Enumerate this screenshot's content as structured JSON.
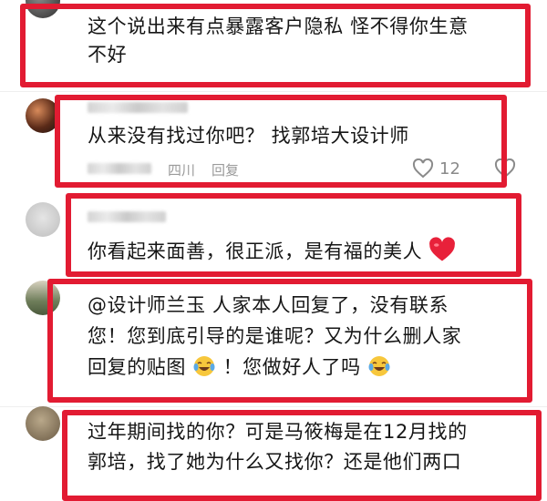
{
  "comments": [
    {
      "text_lines": [
        "这个说出来有点暴露客户隐私 怪不得你生意",
        "不好"
      ]
    },
    {
      "text_lines": [
        "从来没有找过你吧？ 找郭培大设计师"
      ],
      "meta": {
        "location": "四川",
        "reply_label": "回复"
      },
      "likes": "12"
    },
    {
      "text_lines": [
        "你看起来面善，很正派，是有福的美人"
      ],
      "emoji": "red-heart"
    },
    {
      "text_lines": [
        "@设计师兰玉 人家本人回复了，没有联系",
        "您！您到底引导的是谁呢？又为什么删人家",
        "回复的贴图",
        "！您做好人了吗 "
      ],
      "emoji": "tears-of-joy"
    },
    {
      "text_lines": [
        "过年期间找的你？可是马筱梅是在12月找的",
        "郭培，找了她为什么又找你？还是他们两口"
      ]
    }
  ],
  "colors": {
    "highlight": "#e21b32",
    "text": "#161616",
    "meta": "#9a9a9a"
  }
}
